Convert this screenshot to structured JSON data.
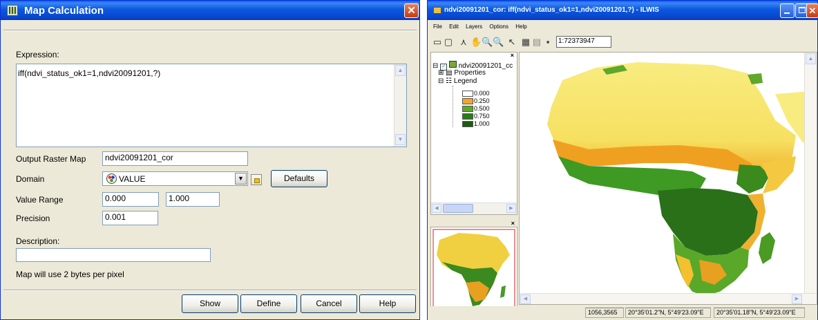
{
  "dialog": {
    "title": "Map Calculation",
    "close_glyph": "✕",
    "expression_label": "Expression:",
    "expression_value": "iff(ndvi_status_ok1=1,ndvi20091201,?)",
    "output_label": "Output Raster Map",
    "output_value": "ndvi20091201_cor",
    "domain_label": "Domain",
    "domain_value": "VALUE",
    "defaults_label": "Defaults",
    "range_label": "Value Range",
    "range_min": "0.000",
    "range_max": "1.000",
    "precision_label": "Precision",
    "precision_value": "0.001",
    "description_label": "Description:",
    "description_value": "",
    "info_text": "Map will use 2 bytes per pixel",
    "buttons": {
      "show": "Show",
      "define": "Define",
      "cancel": "Cancel",
      "help": "Help"
    }
  },
  "ilwis": {
    "title": "ndvi20091201_cor: iff(ndvi_status_ok1=1,ndvi20091201,?) - ILWIS",
    "menu": [
      "File",
      "Edit",
      "Layers",
      "Options",
      "Help"
    ],
    "scale_value": "1:72373947",
    "tree": {
      "root": "ndvi20091201_cc",
      "properties": "Properties",
      "legend": "Legend"
    },
    "legend": [
      {
        "label": "0.000",
        "color": "#ffffff"
      },
      {
        "label": "0.250",
        "color": "#f5a623"
      },
      {
        "label": "0.500",
        "color": "#5fa82a"
      },
      {
        "label": "0.750",
        "color": "#2d7a1c"
      },
      {
        "label": "1.000",
        "color": "#1e5a14"
      }
    ],
    "status": {
      "pixel": "1056,3565",
      "coord1": "20°35'01.2\"N, 5°49'23.09\"E",
      "coord2": "20°35'01.18\"N, 5°49'23.09\"E"
    }
  }
}
